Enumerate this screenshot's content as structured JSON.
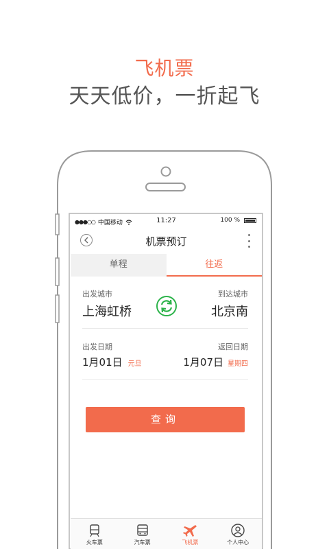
{
  "promo": {
    "title": "飞机票",
    "subtitle": "天天低价，一折起飞"
  },
  "status_bar": {
    "carrier": "中国移动",
    "time": "11:27",
    "battery": "100 %"
  },
  "navbar": {
    "title": "机票预订"
  },
  "tabs": [
    {
      "label": "单程",
      "active": false
    },
    {
      "label": "往返",
      "active": true
    }
  ],
  "route": {
    "departure_label": "出发城市",
    "departure_city": "上海虹桥",
    "arrival_label": "到达城市",
    "arrival_city": "北京南"
  },
  "dates": {
    "depart_label": "出发日期",
    "depart_date": "1月01日",
    "depart_note": "元旦",
    "return_label": "返回日期",
    "return_date": "1月07日",
    "return_note": "星期四"
  },
  "search_button": "查询",
  "bottom_tabs": [
    {
      "label": "火车票",
      "icon": "train-icon",
      "active": false
    },
    {
      "label": "汽车票",
      "icon": "bus-icon",
      "active": false
    },
    {
      "label": "飞机票",
      "icon": "plane-icon",
      "active": true
    },
    {
      "label": "个人中心",
      "icon": "user-icon",
      "active": false
    }
  ],
  "colors": {
    "accent": "#f26b4c",
    "swap": "#2cb34a"
  }
}
